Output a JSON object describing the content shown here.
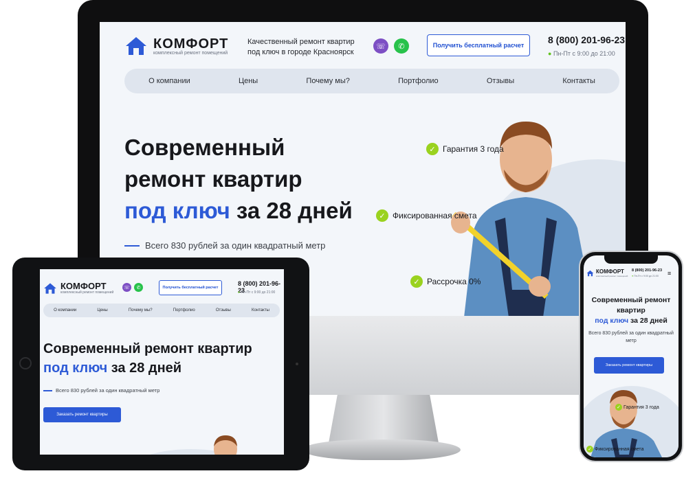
{
  "brand": {
    "name": "КОМФОРТ",
    "subtitle": "комплексный ремонт помещений"
  },
  "tagline": "Качественный ремонт квартир под ключ в городе Красноярск",
  "messengers": {
    "viber_icon": "viber-icon",
    "whatsapp_icon": "whatsapp-icon"
  },
  "header": {
    "cta_label": "Получить бесплатный расчет",
    "phone": "8 (800) 201-96-23",
    "hours": "Пн-Пт с 9:00 до 21:00"
  },
  "nav": {
    "items": [
      {
        "label": "О компании"
      },
      {
        "label": "Цены"
      },
      {
        "label": "Почему мы?"
      },
      {
        "label": "Портфолио"
      },
      {
        "label": "Отзывы"
      },
      {
        "label": "Контакты"
      }
    ]
  },
  "hero": {
    "title_line1": "Современный",
    "title_line2": "ремонт квартир",
    "title_tablet_line1": "Современный ремонт квартир",
    "title_phone_line1": "Современный ремонт",
    "title_phone_line2": "квартир",
    "title_accent": "под ключ",
    "title_tail": "за 28 дней",
    "subtitle": "Всего 830 рублей за один квадратный метр",
    "order_button": "Заказать ремонт квартиры"
  },
  "features": [
    {
      "label": "Гарантия 3 года"
    },
    {
      "label": "Фиксированная смета"
    },
    {
      "label": "Рассрочка 0%"
    }
  ],
  "colors": {
    "accent": "#2d5ad6",
    "check": "#9ad21f",
    "viber": "#7d4fc4",
    "whatsapp": "#28c24b"
  }
}
